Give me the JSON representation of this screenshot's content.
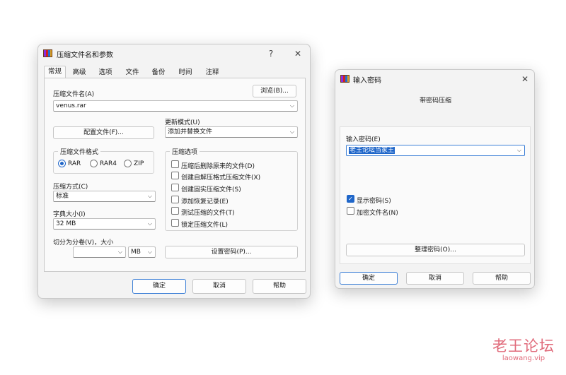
{
  "archive_dialog": {
    "title": "压缩文件名和参数",
    "help_button": "?",
    "close_button": "✕",
    "tabs": [
      "常规",
      "高级",
      "选项",
      "文件",
      "备份",
      "时间",
      "注释"
    ],
    "archive_name_label": "压缩文件名(A)",
    "archive_name_value": "venus.rar",
    "browse_button": "浏览(B)...",
    "profiles_button": "配置文件(F)...",
    "update_mode_label": "更新模式(U)",
    "update_mode_value": "添加并替换文件",
    "format_group": "压缩文件格式",
    "format_options": [
      "RAR",
      "RAR4",
      "ZIP"
    ],
    "format_selected": "RAR",
    "method_label": "压缩方式(C)",
    "method_value": "标准",
    "dict_label": "字典大小(I)",
    "dict_value": "32 MB",
    "split_label": "切分为分卷(V)，大小",
    "split_value": "",
    "split_unit": "MB",
    "options_group": "压缩选项",
    "options": [
      {
        "label": "压缩后删除原来的文件(D)",
        "checked": false
      },
      {
        "label": "创建自解压格式压缩文件(X)",
        "checked": false
      },
      {
        "label": "创建固实压缩文件(S)",
        "checked": false
      },
      {
        "label": "添加恢复记录(E)",
        "checked": false
      },
      {
        "label": "测试压缩的文件(T)",
        "checked": false
      },
      {
        "label": "锁定压缩文件(L)",
        "checked": false
      }
    ],
    "set_password_button": "设置密码(P)...",
    "ok_button": "确定",
    "cancel_button": "取消",
    "help_bottom_button": "帮助"
  },
  "password_dialog": {
    "title": "输入密码",
    "close_button": "✕",
    "heading": "带密码压缩",
    "password_label": "输入密码(E)",
    "password_value": "老王论坛当家王",
    "show_password_label": "显示密码(S)",
    "show_password_checked": true,
    "encrypt_names_label": "加密文件名(N)",
    "encrypt_names_checked": false,
    "organize_button": "整理密码(O)...",
    "ok_button": "确定",
    "cancel_button": "取消",
    "help_button": "帮助"
  },
  "watermark": {
    "text": "老王论坛",
    "url": "laowang.vip",
    "color": "#e06a7a"
  },
  "colors": {
    "accent": "#1f66c9",
    "selection": "#1f66c9"
  }
}
